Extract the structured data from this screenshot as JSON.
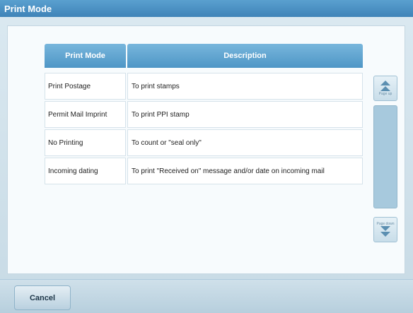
{
  "window": {
    "title": "Print Mode"
  },
  "table": {
    "headers": [
      "Print Mode",
      "Description"
    ],
    "rows": [
      {
        "mode": "Print Postage",
        "description": "To print stamps"
      },
      {
        "mode": "Permit Mail Imprint",
        "description": "To print PPI stamp"
      },
      {
        "mode": "No Printing",
        "description": "To count or \"seal only\""
      },
      {
        "mode": "Incoming dating",
        "description": "To print \"Received on\" message and/or date on incoming mail"
      }
    ]
  },
  "pager": {
    "up_label": "Page up",
    "down_label": "Page down"
  },
  "footer": {
    "cancel_label": "Cancel"
  },
  "colors": {
    "header": "#4e96c6",
    "titlebar": "#3f83b8",
    "scrollbar": "#a7c9dd"
  }
}
